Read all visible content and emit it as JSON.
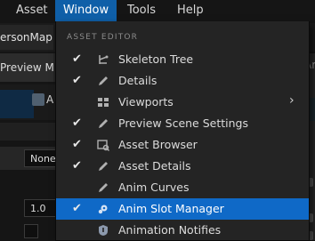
{
  "menubar": {
    "items": [
      "Asset",
      "Window",
      "Tools",
      "Help"
    ],
    "active": "Window"
  },
  "background": {
    "tab_label": "ersonMap",
    "toolbar_label": "Preview Me",
    "row_label": "A",
    "field_none": "None",
    "field_value": "1.0",
    "right_text": "Ar"
  },
  "menu": {
    "section_header": "ASSET EDITOR",
    "items": [
      {
        "label": "Skeleton Tree",
        "checked": true,
        "icon": "skeleton-tree-icon"
      },
      {
        "label": "Details",
        "checked": true,
        "icon": "details-pencil-icon"
      },
      {
        "label": "Viewports",
        "checked": false,
        "icon": "viewports-grid-icon",
        "submenu": true
      },
      {
        "label": "Preview Scene Settings",
        "checked": true,
        "icon": "preview-scene-pencil-icon"
      },
      {
        "label": "Asset Browser",
        "checked": true,
        "icon": "asset-browser-icon"
      },
      {
        "label": "Asset Details",
        "checked": true,
        "icon": "asset-details-pencil-icon"
      },
      {
        "label": "Anim Curves",
        "checked": false,
        "icon": "anim-curves-pencil-icon"
      },
      {
        "label": "Anim Slot Manager",
        "checked": true,
        "icon": "anim-slot-manager-icon",
        "highlighted": true
      },
      {
        "label": "Animation Notifies",
        "checked": false,
        "icon": "animation-notifies-icon"
      }
    ]
  },
  "colors": {
    "highlight": "#0f69c7",
    "menu_bg": "#242424",
    "menubar_active": "#0f5fa8"
  }
}
